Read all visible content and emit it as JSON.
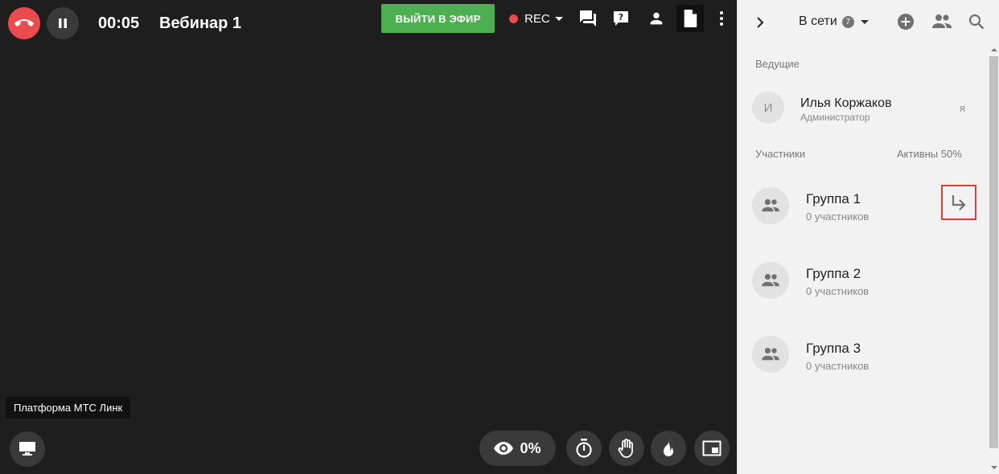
{
  "header": {
    "timer": "00:05",
    "title": "Вебинар 1",
    "go_live_label": "ВЫЙТИ В ЭФИР",
    "rec_label": "REC"
  },
  "stage": {
    "tooltip": "Платформа МТС Линк",
    "viewers_percent": "0%"
  },
  "panel": {
    "online_label": "В сети",
    "online_count": "7",
    "hosts_title": "Ведущие",
    "host": {
      "initial": "И",
      "name": "Илья Коржаков",
      "role": "Администратор",
      "me_label": "я"
    },
    "participants_title": "Участники",
    "active_label": "Активны 50%",
    "groups": [
      {
        "name": "Группа 1",
        "count": "0 участников"
      },
      {
        "name": "Группа 2",
        "count": "0 участников"
      },
      {
        "name": "Группа 3",
        "count": "0 участников"
      }
    ]
  },
  "colors": {
    "end_call": "#ec4b4e",
    "go_live": "#4caf50",
    "rec_dot": "#ec4b4e",
    "highlight": "#e53935",
    "stage_bg": "#1e1e1e",
    "panel_bg": "#f2f2f2"
  }
}
